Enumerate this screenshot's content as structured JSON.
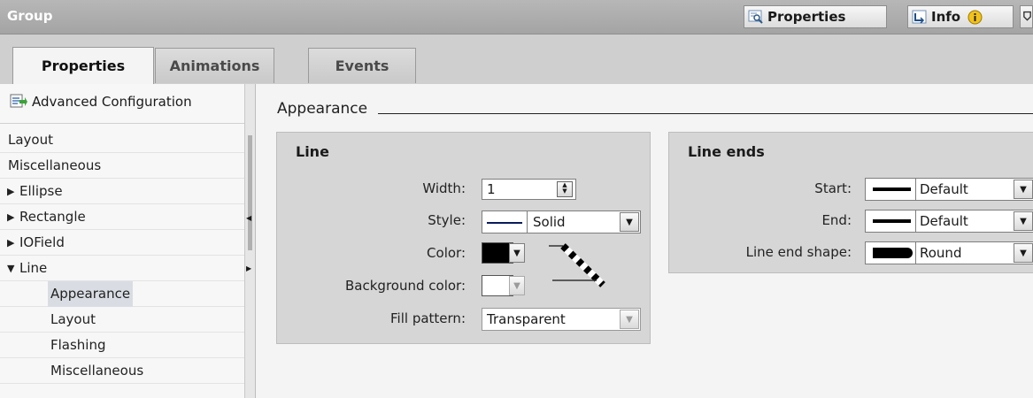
{
  "window": {
    "title": "Group"
  },
  "toolbar": {
    "properties_label": "Properties",
    "info_label": "Info",
    "info_badge_icon": "info-circle-icon"
  },
  "tabs": [
    {
      "label": "Properties",
      "active": true
    },
    {
      "label": "Animations",
      "active": false
    },
    {
      "label": "Events",
      "active": false
    }
  ],
  "nav": {
    "advanced_configuration": "Advanced Configuration",
    "items": [
      {
        "label": "Layout"
      },
      {
        "label": "Miscellaneous"
      },
      {
        "label": "Ellipse",
        "expander": "collapsed"
      },
      {
        "label": "Rectangle",
        "expander": "collapsed"
      },
      {
        "label": "IOField",
        "expander": "collapsed"
      },
      {
        "label": "Line",
        "expander": "expanded"
      },
      {
        "label": "Appearance",
        "selected": true
      },
      {
        "label": "Layout"
      },
      {
        "label": "Flashing"
      },
      {
        "label": "Miscellaneous"
      }
    ]
  },
  "main": {
    "section_title": "Appearance",
    "line_panel": {
      "title": "Line",
      "width_label": "Width:",
      "width_value": "1",
      "style_label": "Style:",
      "style_value": "Solid",
      "color_label": "Color:",
      "color_value": "#000000",
      "background_color_label": "Background color:",
      "background_color_value": "#ffffff",
      "fill_pattern_label": "Fill pattern:",
      "fill_pattern_value": "Transparent"
    },
    "line_ends_panel": {
      "title": "Line ends",
      "start_label": "Start:",
      "start_value": "Default",
      "end_label": "End:",
      "end_value": "Default",
      "shape_label": "Line end shape:",
      "shape_value": "Round"
    }
  },
  "colors": {
    "titlebar": "#a8a8a8",
    "panel": "#d6d6d6",
    "selected_nav": "#d9dde3"
  }
}
